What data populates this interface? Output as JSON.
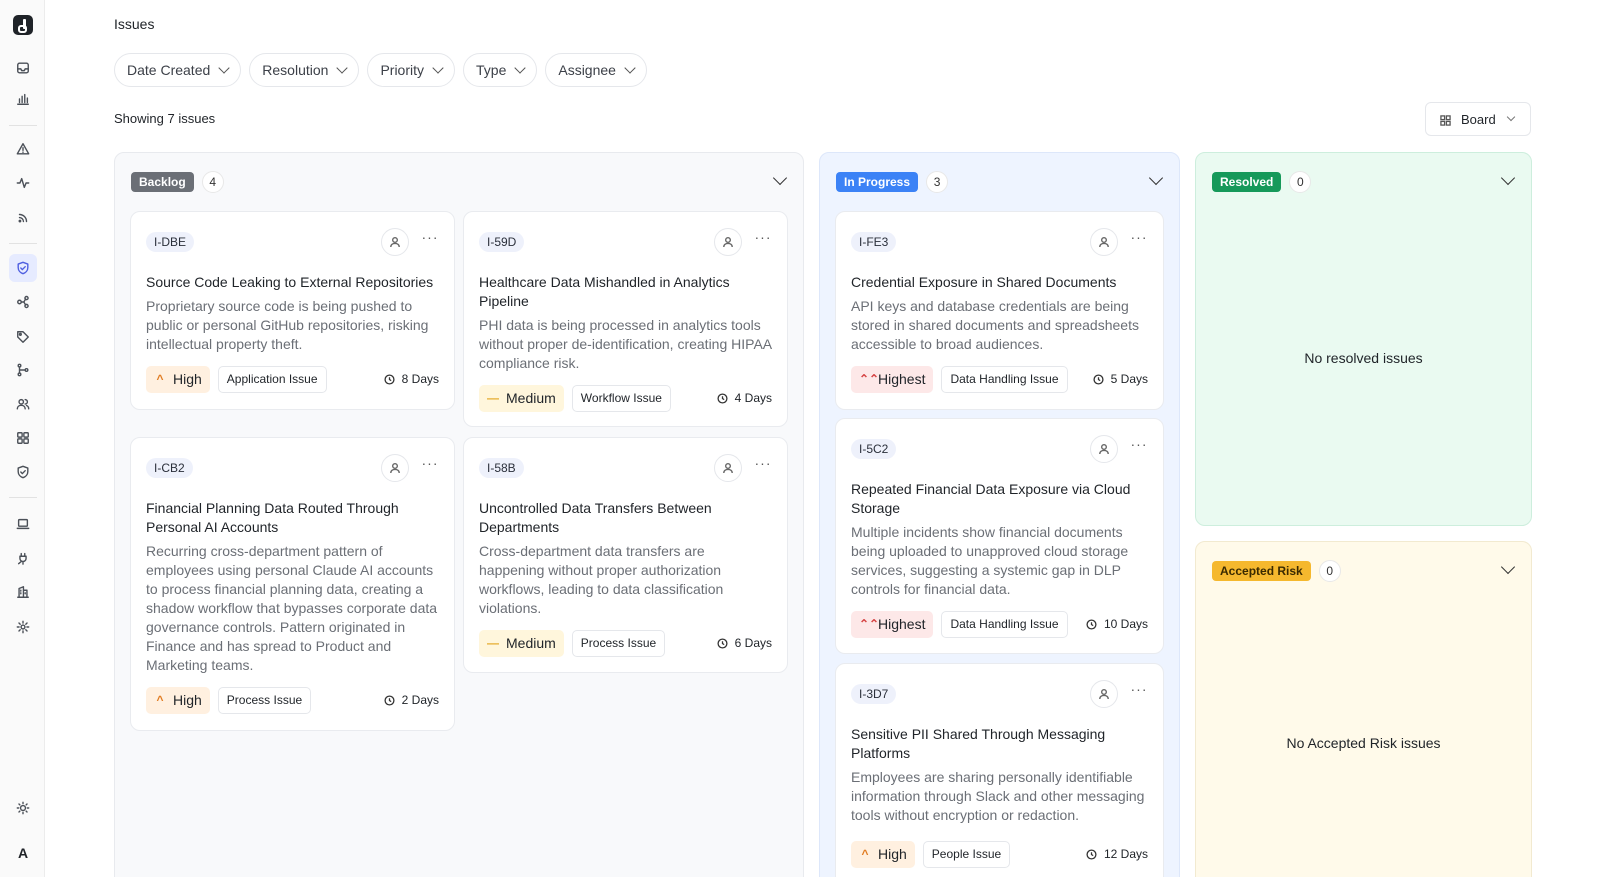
{
  "page": {
    "title": "Issues",
    "showing": "Showing 7 issues"
  },
  "filters": [
    "Date Created",
    "Resolution",
    "Priority",
    "Type",
    "Assignee"
  ],
  "view": {
    "label": "Board"
  },
  "sidebar": {
    "logo": "logo",
    "items": [
      "inbox-icon",
      "chart-icon",
      "alert-icon",
      "activity-icon",
      "feed-icon",
      "shield-icon",
      "workflow-icon",
      "tag-icon",
      "branch-icon",
      "users-icon",
      "apps-icon",
      "shield-check-icon",
      "laptop-icon",
      "plug-icon",
      "building-icon",
      "settings-icon"
    ],
    "theme_icon": "sun-icon",
    "avatar": "A"
  },
  "colors": {
    "accent": "#4f5fe0",
    "backlog": "#6b6f76",
    "in_progress": "#3b82f6",
    "resolved": "#16995a",
    "accepted_risk": "#f5b82e"
  },
  "columns": {
    "backlog": {
      "label": "Backlog",
      "count": "4",
      "cards": [
        {
          "id": "I-DBE",
          "title": "Source Code Leaking to External Repositories",
          "desc": "Proprietary source code is being pushed to public or personal GitHub repositories, risking intellectual property theft.",
          "priority": "High",
          "priority_icon": "^",
          "type": "Application Issue",
          "age": "8 Days"
        },
        {
          "id": "I-59D",
          "title": "Healthcare Data Mishandled in Analytics Pipeline",
          "desc": "PHI data is being processed in analytics tools without proper de-identification, creating HIPAA compliance risk.",
          "priority": "Medium",
          "priority_icon": "—",
          "type": "Workflow Issue",
          "age": "4 Days"
        },
        {
          "id": "I-CB2",
          "title": "Financial Planning Data Routed Through Personal AI Accounts",
          "desc": "Recurring cross-department pattern of employees using personal Claude AI accounts to process financial planning data, creating a shadow workflow that bypasses corporate data governance controls. Pattern originated in Finance and has spread to Product and Marketing teams.",
          "priority": "High",
          "priority_icon": "^",
          "type": "Process Issue",
          "age": "2 Days"
        },
        {
          "id": "I-58B",
          "title": "Uncontrolled Data Transfers Between Departments",
          "desc": "Cross-department data transfers are happening without proper authorization workflows, leading to data classification violations.",
          "priority": "Medium",
          "priority_icon": "—",
          "type": "Process Issue",
          "age": "6 Days"
        }
      ]
    },
    "in_progress": {
      "label": "In Progress",
      "count": "3",
      "cards": [
        {
          "id": "I-FE3",
          "title": "Credential Exposure in Shared Documents",
          "desc": "API keys and database credentials are being stored in shared documents and spreadsheets accessible to broad audiences.",
          "priority": "Highest",
          "priority_icon": "⌃⌃",
          "type": "Data Handling Issue",
          "age": "5 Days"
        },
        {
          "id": "I-5C2",
          "title": "Repeated Financial Data Exposure via Cloud Storage",
          "desc": "Multiple incidents show financial documents being uploaded to unapproved cloud storage services, suggesting a systemic gap in DLP controls for financial data.",
          "priority": "Highest",
          "priority_icon": "⌃⌃",
          "type": "Data Handling Issue",
          "age": "10 Days"
        },
        {
          "id": "I-3D7",
          "title": "Sensitive PII Shared Through Messaging Platforms",
          "desc": "Employees are sharing personally identifiable information through Slack and other messaging tools without encryption or redaction.",
          "priority": "High",
          "priority_icon": "^",
          "type": "People Issue",
          "age": "12 Days"
        }
      ]
    },
    "resolved": {
      "label": "Resolved",
      "count": "0",
      "empty": "No resolved issues"
    },
    "accepted_risk": {
      "label": "Accepted Risk",
      "count": "0",
      "empty": "No Accepted Risk issues"
    }
  }
}
